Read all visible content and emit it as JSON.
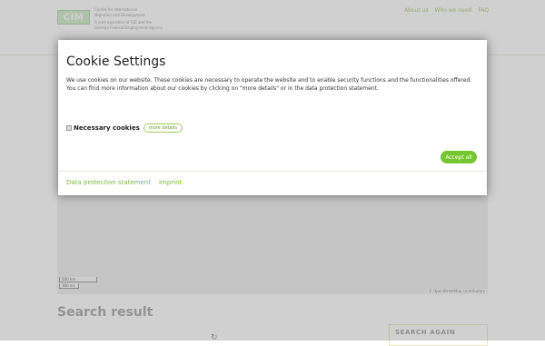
{
  "header": {
    "logo_mark": "CIM",
    "logo_line1": "Centre for International",
    "logo_line2": "Migration and Development",
    "logo_line3": "A joint operation of GIZ and the",
    "logo_line4": "German Federal Employment Agency",
    "nav": [
      "About us",
      "Who we need",
      "FAQ"
    ]
  },
  "map": {
    "scale_metric": "500 km",
    "scale_imperial": "300 mi",
    "attribution": "© OpenStreetMap contributors"
  },
  "results": {
    "title": "Search result",
    "spinner_icon": "↻",
    "search_again": "SEARCH AGAIN"
  },
  "cookie_dialog": {
    "title": "Cookie Settings",
    "text": "We use cookies on our website. These cookies are necessary to operate the website and to enable security functions and the functionalities offered. You can find more information about our cookies by clicking on \"more details\" or in the data protection statement.",
    "necessary_label": "Necessary cookies",
    "more_details": "more details",
    "accept_all": "Accept all",
    "footer_links": [
      "Data protection statement",
      "Imprint"
    ]
  },
  "colors": {
    "accent": "#76c631",
    "link": "#7ab83a"
  }
}
